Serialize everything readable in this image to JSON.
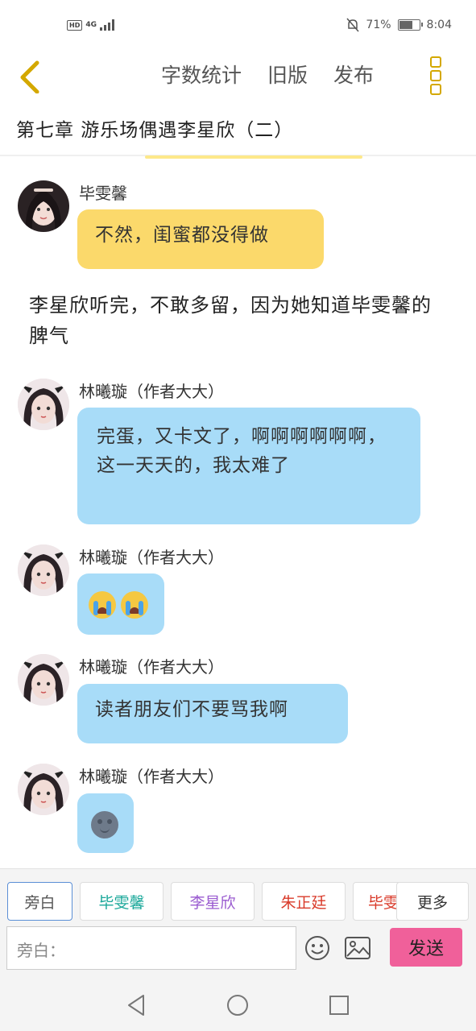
{
  "status_bar": {
    "network": "4G",
    "hd": "HD",
    "battery_percent_text": "71%",
    "battery_level": 0.71,
    "time": "8:04"
  },
  "top_bar": {
    "word_count_label": "字数统计",
    "old_version_label": "旧版",
    "publish_label": "发布"
  },
  "chapter_title": "第七章 游乐场偶遇李星欣（二）",
  "messages": [
    {
      "sender": "毕雯馨",
      "text": "不然，闺蜜都没得做"
    },
    {
      "sender": "林曦璇（作者大大）",
      "text": "完蛋，又卡文了，啊啊啊啊啊啊，这一天天的，我太难了"
    },
    {
      "sender": "林曦璇（作者大大）",
      "emoji": [
        "crying-face",
        "crying-face"
      ]
    },
    {
      "sender": "林曦璇（作者大大）",
      "text": "读者朋友们不要骂我啊"
    },
    {
      "sender": "林曦璇（作者大大）",
      "emoji": [
        "new-moon-face"
      ]
    }
  ],
  "narration": "李星欣听完，不敢多留，因为她知道毕雯馨的脾气",
  "roles": [
    {
      "label": "旁白",
      "color": "#555555"
    },
    {
      "label": "毕雯馨",
      "color": "#1aa89a"
    },
    {
      "label": "李星欣",
      "color": "#9a5bd0"
    },
    {
      "label": "朱正廷",
      "color": "#d93a2a"
    },
    {
      "label": "毕雯",
      "color": "#d93a2a"
    }
  ],
  "more_label": "更多",
  "input": {
    "placeholder": "旁白："
  },
  "send_label": "发送",
  "colors": {
    "accent_yellow": "#fbd96b",
    "bubble_blue": "#a8dcf8",
    "send_pink": "#f0609a"
  }
}
